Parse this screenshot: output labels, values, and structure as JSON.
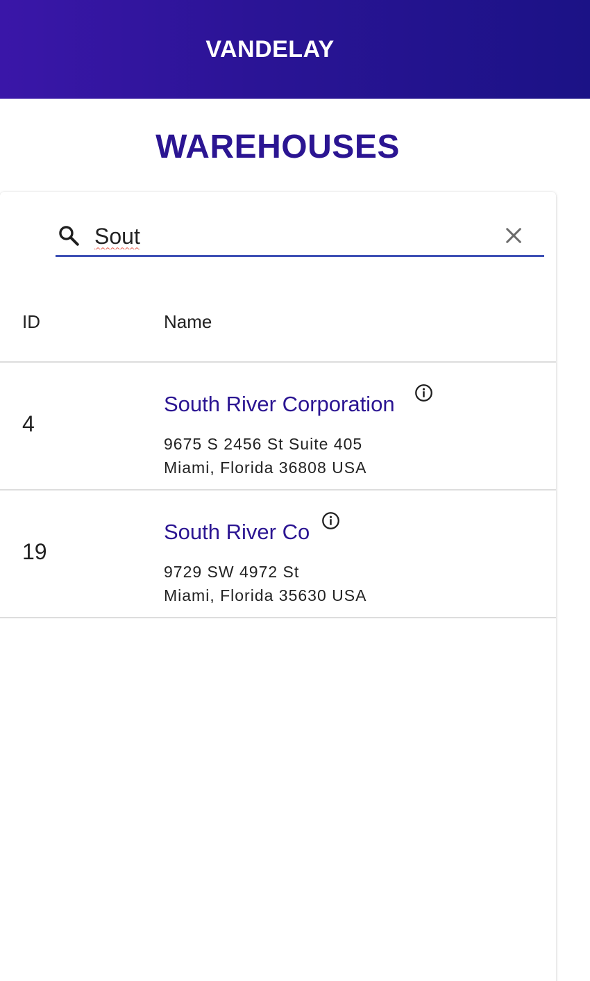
{
  "header": {
    "app_title": "VANDELAY"
  },
  "page": {
    "title": "WAREHOUSES"
  },
  "search": {
    "value": "Sout",
    "placeholder": ""
  },
  "table": {
    "columns": [
      "ID",
      "Name"
    ],
    "rows": [
      {
        "id": "4",
        "name": "South River Corporation",
        "address_line1": "9675 S 2456 St Suite 405",
        "address_line2": "Miami, Florida 36808 USA"
      },
      {
        "id": "19",
        "name": "South River Co",
        "address_line1": "9729 SW 4972 St",
        "address_line2": "Miami, Florida 35630 USA"
      }
    ]
  },
  "icons": {
    "search": "search-icon",
    "clear": "close-icon",
    "info": "info-icon"
  },
  "colors": {
    "header_gradient_start": "#3a16a8",
    "header_gradient_end": "#1b1286",
    "accent": "#2b1592",
    "search_underline": "#3f51b5"
  }
}
